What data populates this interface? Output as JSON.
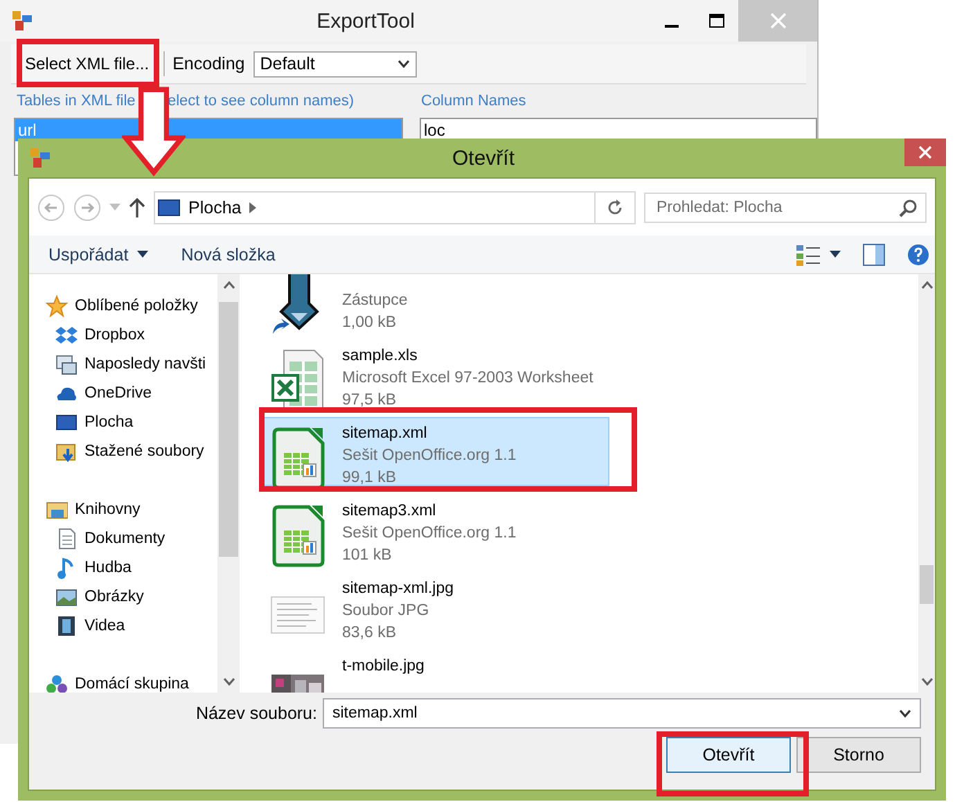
{
  "main_window": {
    "title": "ExportTool",
    "toolbar": {
      "select_button": "Select XML file...",
      "encoding_label": "Encoding",
      "encoding_value": "Default"
    },
    "tables_label": [
      "Tables in XML file",
      "elect to see column names)"
    ],
    "tables": [
      {
        "name": "url",
        "selected": true
      }
    ],
    "columns_label": "Column Names",
    "columns": [
      "loc"
    ]
  },
  "dialog": {
    "title": "Otevřít",
    "location": "Plocha",
    "search": {
      "placeholder": "Prohledat: Plocha"
    },
    "organize": "Uspořádat",
    "new_folder": "Nová složka",
    "nav": [
      {
        "label": "Oblíbené položky",
        "kind": "star",
        "children": [
          {
            "label": "Dropbox",
            "kind": "dropbox"
          },
          {
            "label": "Naposledy navšti",
            "kind": "recent"
          },
          {
            "label": "OneDrive",
            "kind": "cloud"
          },
          {
            "label": "Plocha",
            "kind": "desktop"
          },
          {
            "label": "Stažené soubory",
            "kind": "downloads"
          }
        ]
      },
      {
        "label": "Knihovny",
        "kind": "library",
        "children": [
          {
            "label": "Dokumenty",
            "kind": "document"
          },
          {
            "label": "Hudba",
            "kind": "music"
          },
          {
            "label": "Obrázky",
            "kind": "pictures"
          },
          {
            "label": "Videa",
            "kind": "video"
          }
        ]
      },
      {
        "label": "Domácí skupina",
        "kind": "homegroup"
      }
    ],
    "files": [
      {
        "type": "Zástupce",
        "size": "1,00 kB",
        "kind": "shortcut",
        "selected": false
      },
      {
        "name": "sample.xls",
        "type": "Microsoft Excel 97-2003 Worksheet",
        "size": "97,5 kB",
        "kind": "excel",
        "selected": false
      },
      {
        "name": "sitemap.xml",
        "type": "Sešit OpenOffice.org 1.1",
        "size": "99,1 kB",
        "kind": "calc",
        "selected": true
      },
      {
        "name": "sitemap3.xml",
        "type": "Sešit OpenOffice.org 1.1",
        "size": "101 kB",
        "kind": "calc",
        "selected": false
      },
      {
        "name": "sitemap-xml.jpg",
        "type": "Soubor JPG",
        "size": "83,6 kB",
        "selected": false
      },
      {
        "name": "t-mobile.jpg",
        "selected": false
      }
    ],
    "filename_label": "Název souboru:",
    "filename": "sitemap.xml",
    "buttons": [
      {
        "label": "Otevřít",
        "kind": "primary"
      },
      {
        "label": "Storno",
        "kind": "normal"
      }
    ]
  }
}
